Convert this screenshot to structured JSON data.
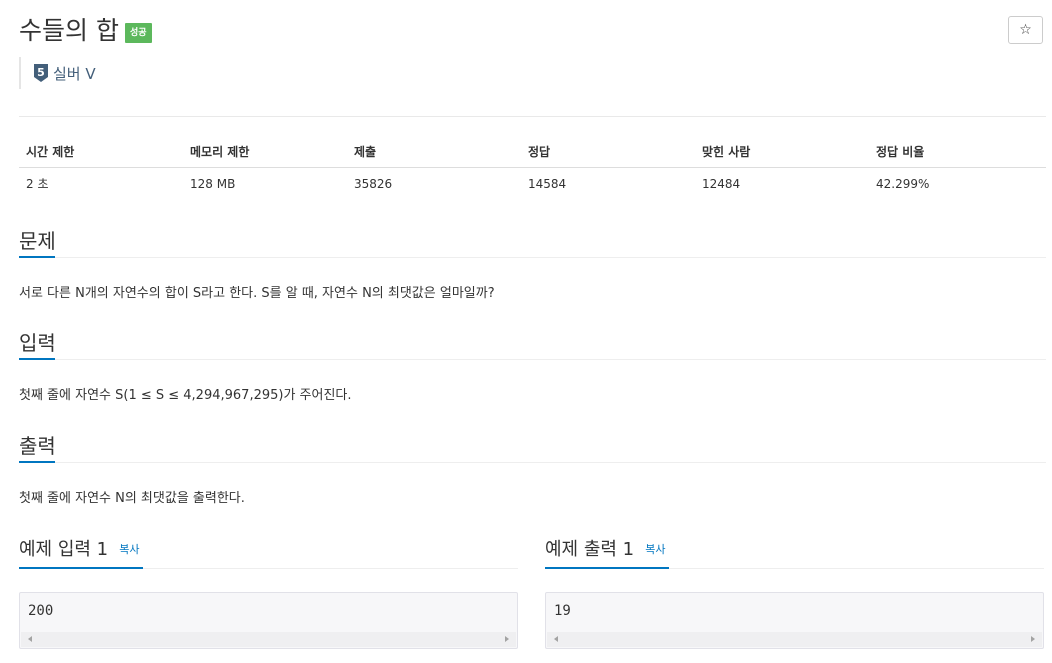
{
  "header": {
    "title": "수들의 합",
    "result_badge": "성공",
    "star_icon": "☆",
    "tier_number": "5",
    "tier_label": "실버 V",
    "tier_color": "#435f7a"
  },
  "info_table": {
    "columns": [
      "시간 제한",
      "메모리 제한",
      "제출",
      "정답",
      "맞힌 사람",
      "정답 비율"
    ],
    "values": [
      "2 초",
      "128 MB",
      "35826",
      "14584",
      "12484",
      "42.299%"
    ]
  },
  "sections": {
    "problem": {
      "title": "문제",
      "text": "서로 다른 N개의 자연수의 합이 S라고 한다. S를 알 때, 자연수 N의 최댓값은 얼마일까?"
    },
    "input": {
      "title": "입력",
      "text": "첫째 줄에 자연수 S(1 ≤ S ≤ 4,294,967,295)가 주어진다."
    },
    "output": {
      "title": "출력",
      "text": "첫째 줄에 자연수 N의 최댓값을 출력한다."
    }
  },
  "samples": {
    "input": {
      "title": "예제 입력 1",
      "copy_label": "복사",
      "value": "200"
    },
    "output": {
      "title": "예제 출력 1",
      "copy_label": "복사",
      "value": "19"
    }
  },
  "colors": {
    "accent": "#0076c0",
    "success": "#5cb85c"
  }
}
